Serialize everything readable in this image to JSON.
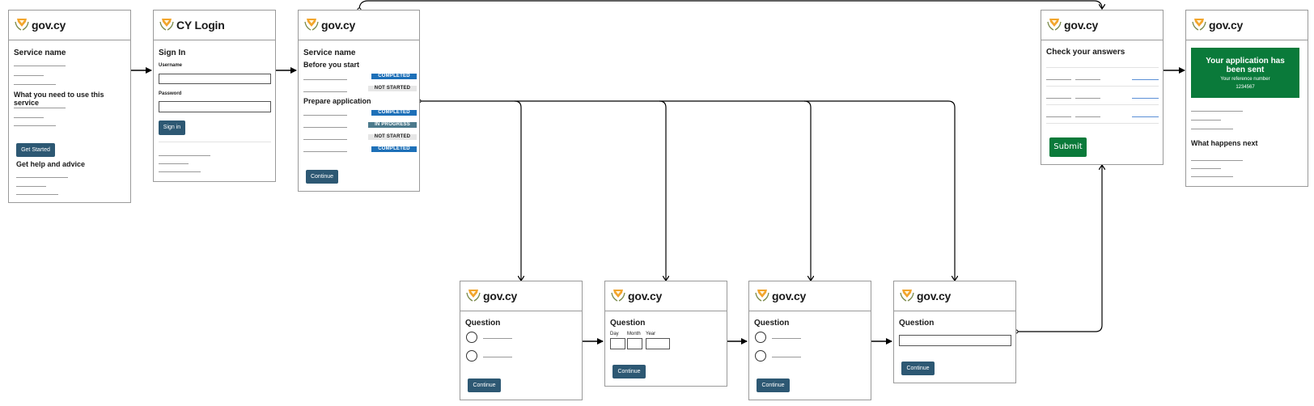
{
  "brand": {
    "name": "gov.cy",
    "login_name": "CY Login",
    "logo_icon": "cyprus-emblem-icon",
    "colors": {
      "primary_button": "#2d5873",
      "success_green": "#0a7a3a",
      "tag_completed": "#1d70b8",
      "tag_in_progress": "#4c7a8c",
      "tag_not_started": "#e6e6e6",
      "link_blue": "#5b8fd6",
      "border": "#9a9a9a"
    }
  },
  "screens": {
    "start": {
      "title": "Service name",
      "section_need": "What you need to use this service",
      "button": "Get Started",
      "section_help": "Get help and advice"
    },
    "login": {
      "title": "Sign In",
      "username_label": "Username",
      "username_value": "",
      "password_label": "Password",
      "password_value": "",
      "button": "Sign in"
    },
    "task_list": {
      "title": "Service name",
      "section_before": "Before you start",
      "section_prepare": "Prepare application",
      "tasks": [
        {
          "status": "COMPLETED",
          "type": "completed"
        },
        {
          "status": "NOT STARTED",
          "type": "not_started"
        },
        {
          "status": "COMPLETED",
          "type": "completed"
        },
        {
          "status": "IN PROGRESS",
          "type": "in_progress"
        },
        {
          "status": "NOT STARTED",
          "type": "not_started"
        },
        {
          "status": "COMPLETED",
          "type": "completed"
        }
      ],
      "button": "Continue"
    },
    "question_radio_1": {
      "title": "Question",
      "button": "Continue"
    },
    "question_date": {
      "title": "Question",
      "day_label": "Day",
      "month_label": "Month",
      "year_label": "Year",
      "button": "Continue"
    },
    "question_radio_2": {
      "title": "Question",
      "button": "Continue"
    },
    "question_text": {
      "title": "Question",
      "input_value": "",
      "button": "Continue"
    },
    "check_answers": {
      "title": "Check your answers",
      "button": "Submit"
    },
    "confirmation": {
      "panel_title": "Your application has been sent",
      "reference_label": "Your reference number",
      "reference_number": "1234567",
      "section_next": "What happens next"
    }
  }
}
